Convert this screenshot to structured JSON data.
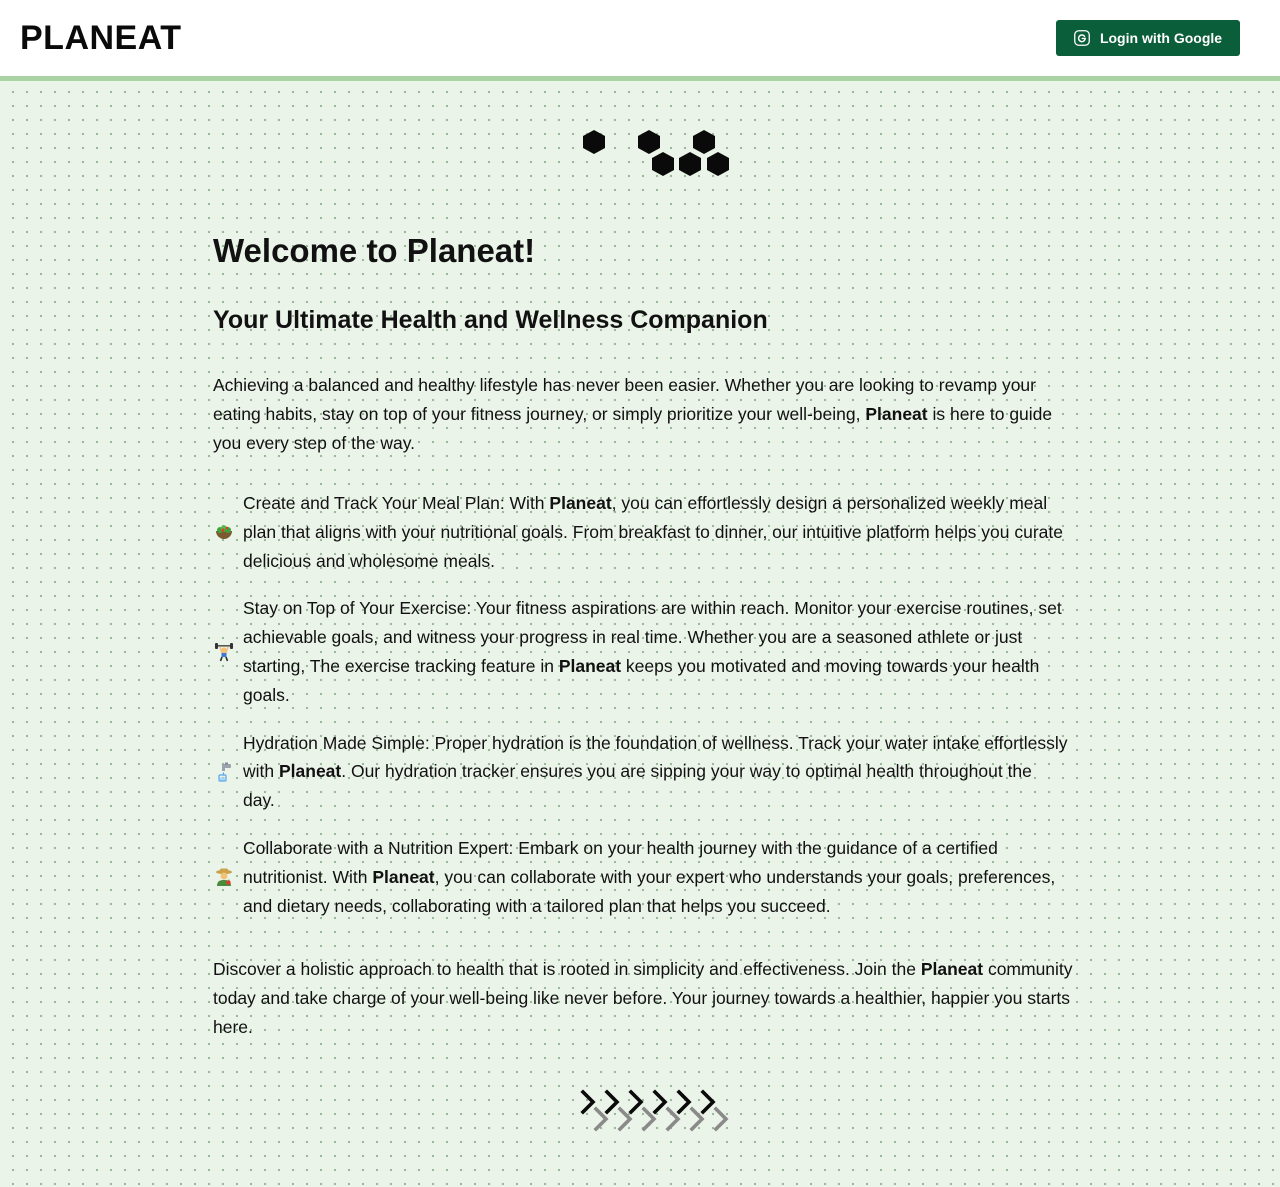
{
  "header": {
    "brand": "PLANEAT",
    "login_label": "Login with Google",
    "button_color": "#0b5e3a",
    "accent_border_color": "#a9d3a3"
  },
  "page": {
    "background_color": "#ebf4e9",
    "title": "Welcome to Planeat!",
    "subtitle": "Your Ultimate Health and Wellness Companion",
    "intro": {
      "before": "Achieving a balanced and healthy lifestyle has never been easier. Whether you are looking to revamp your eating habits, stay on top of your fitness journey, or simply prioritize your well-being, ",
      "brand": "Planeat",
      "after": " is here to guide you every step of the way."
    },
    "features": [
      {
        "icon": "salad-bowl-icon",
        "before": "Create and Track Your Meal Plan: With ",
        "brand": "Planeat",
        "after": ", you can effortlessly design a personalized weekly meal plan that aligns with your nutritional goals. From breakfast to dinner, our intuitive platform helps you curate delicious and wholesome meals."
      },
      {
        "icon": "weightlifter-icon",
        "before": "Stay on Top of Your Exercise: Your fitness aspirations are within reach. Monitor your exercise routines, set achievable goals, and witness your progress in real time. Whether you are a seasoned athlete or just starting, The exercise tracking feature in ",
        "brand": "Planeat",
        "after": " keeps you motivated and moving towards your health goals."
      },
      {
        "icon": "water-tap-icon",
        "before": "Hydration Made Simple: Proper hydration is the foundation of wellness. Track your water intake effortlessly with ",
        "brand": "Planeat",
        "after": ". Our hydration tracker ensures you are sipping your way to optimal health throughout the day."
      },
      {
        "icon": "nutritionist-icon",
        "before": "Collaborate with a Nutrition Expert: Embark on your health journey with the guidance of a certified nutritionist. With ",
        "brand": "Planeat",
        "after": ", you can collaborate with your expert who understands your goals, preferences, and dietary needs, collaborating with a tailored plan that helps you succeed."
      }
    ],
    "closing": {
      "before": "Discover a holistic approach to health that is rooted in simplicity and effectiveness. Join the ",
      "brand": "Planeat",
      "after": " community today and take charge of your well-being like never before. Your journey towards a healthier, happier you starts here."
    }
  }
}
